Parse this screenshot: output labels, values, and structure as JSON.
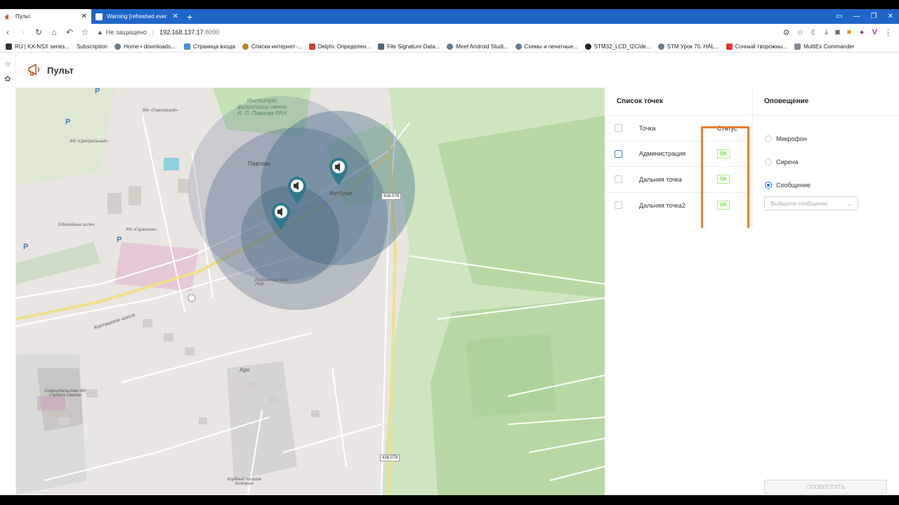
{
  "browser": {
    "tabs": [
      {
        "title": "Пульт",
        "active": true
      },
      {
        "title": "Warning [refreshed ever",
        "active": false
      }
    ],
    "new_tab": "+",
    "window_controls": [
      "▭",
      "—",
      "❐",
      "✕"
    ],
    "nav": {
      "back": "‹",
      "forward": "›",
      "reload": "↻",
      "home": "⌂",
      "undo": "↶",
      "bookmark": "☆"
    },
    "address": {
      "security_icon": "warning-icon",
      "security_label": "Не защищено",
      "host": "192.168.137.17",
      "port": ":8090"
    },
    "extension_icons": [
      "bug-icon",
      "star-icon",
      "moon-icon",
      "download-icon",
      "camera-icon",
      "note-icon",
      "puzzle-icon",
      "vivaldi-icon",
      "menu-icon"
    ],
    "bookmarks": [
      "RU | KX-NSX series...",
      "Subscription",
      "Home • downloads....",
      "Страница входа",
      "Списки интернет-...",
      "Delphi: Определен...",
      "File Signature Data...",
      "Meet Android Studi...",
      "Схемы и печатные...",
      "STM32_LCD_I2C/de...",
      "STM Урок 70. HAL...",
      "Сочный творожны...",
      "MultiEx Commander"
    ]
  },
  "app": {
    "title": "Пульт",
    "logo_icon": "megaphone-icon"
  },
  "map": {
    "labels": {
      "institute": "Институт физиологии имени И. П. Павлова РАН",
      "pavlovo": "Павлово",
      "koltushi": "Колтуши",
      "road1": "41К-078",
      "road2": "41К-078",
      "koltush_shosse": "Колтушское шоссе",
      "aro": "Аро",
      "jk_pavlovsky": "ЖК «Павловский»",
      "jk_central": "ЖК «Центральный»",
      "jk_garmonia": "ЖК «Гармония»",
      "bakery": "Ремонтная база ЛМК",
      "construction": "Строительство ЖК «Чудеса Света»",
      "club": "Клубный поселок Колтуши",
      "jubilee": "Юбилейная аллея"
    },
    "markers": [
      {
        "name": "Администрация",
        "icon": "speaker-icon"
      },
      {
        "name": "Дальняя точка",
        "icon": "speaker-icon"
      },
      {
        "name": "Дальняя точка2",
        "icon": "speaker-icon"
      }
    ]
  },
  "points_panel": {
    "title": "Список точек",
    "col_point": "Точка",
    "col_status": "Статус",
    "rows": [
      {
        "name": "Администрация",
        "status": "OK"
      },
      {
        "name": "Дальняя точка",
        "status": "OK"
      },
      {
        "name": "Дальняя точка2",
        "status": "OK"
      }
    ]
  },
  "notify_panel": {
    "title": "Оповещение",
    "options": [
      {
        "label": "Микрофон",
        "selected": false
      },
      {
        "label": "Сирена",
        "selected": false
      },
      {
        "label": "Сообщение",
        "selected": true
      }
    ],
    "select_placeholder": "Выберите сообщение",
    "button": "ОПОВЕСТИТЬ"
  },
  "colors": {
    "browser_blue": "#1f65c8",
    "highlight_orange": "#ed7d31",
    "status_green": "#52c41a",
    "marker_teal": "#2e7a8c"
  }
}
